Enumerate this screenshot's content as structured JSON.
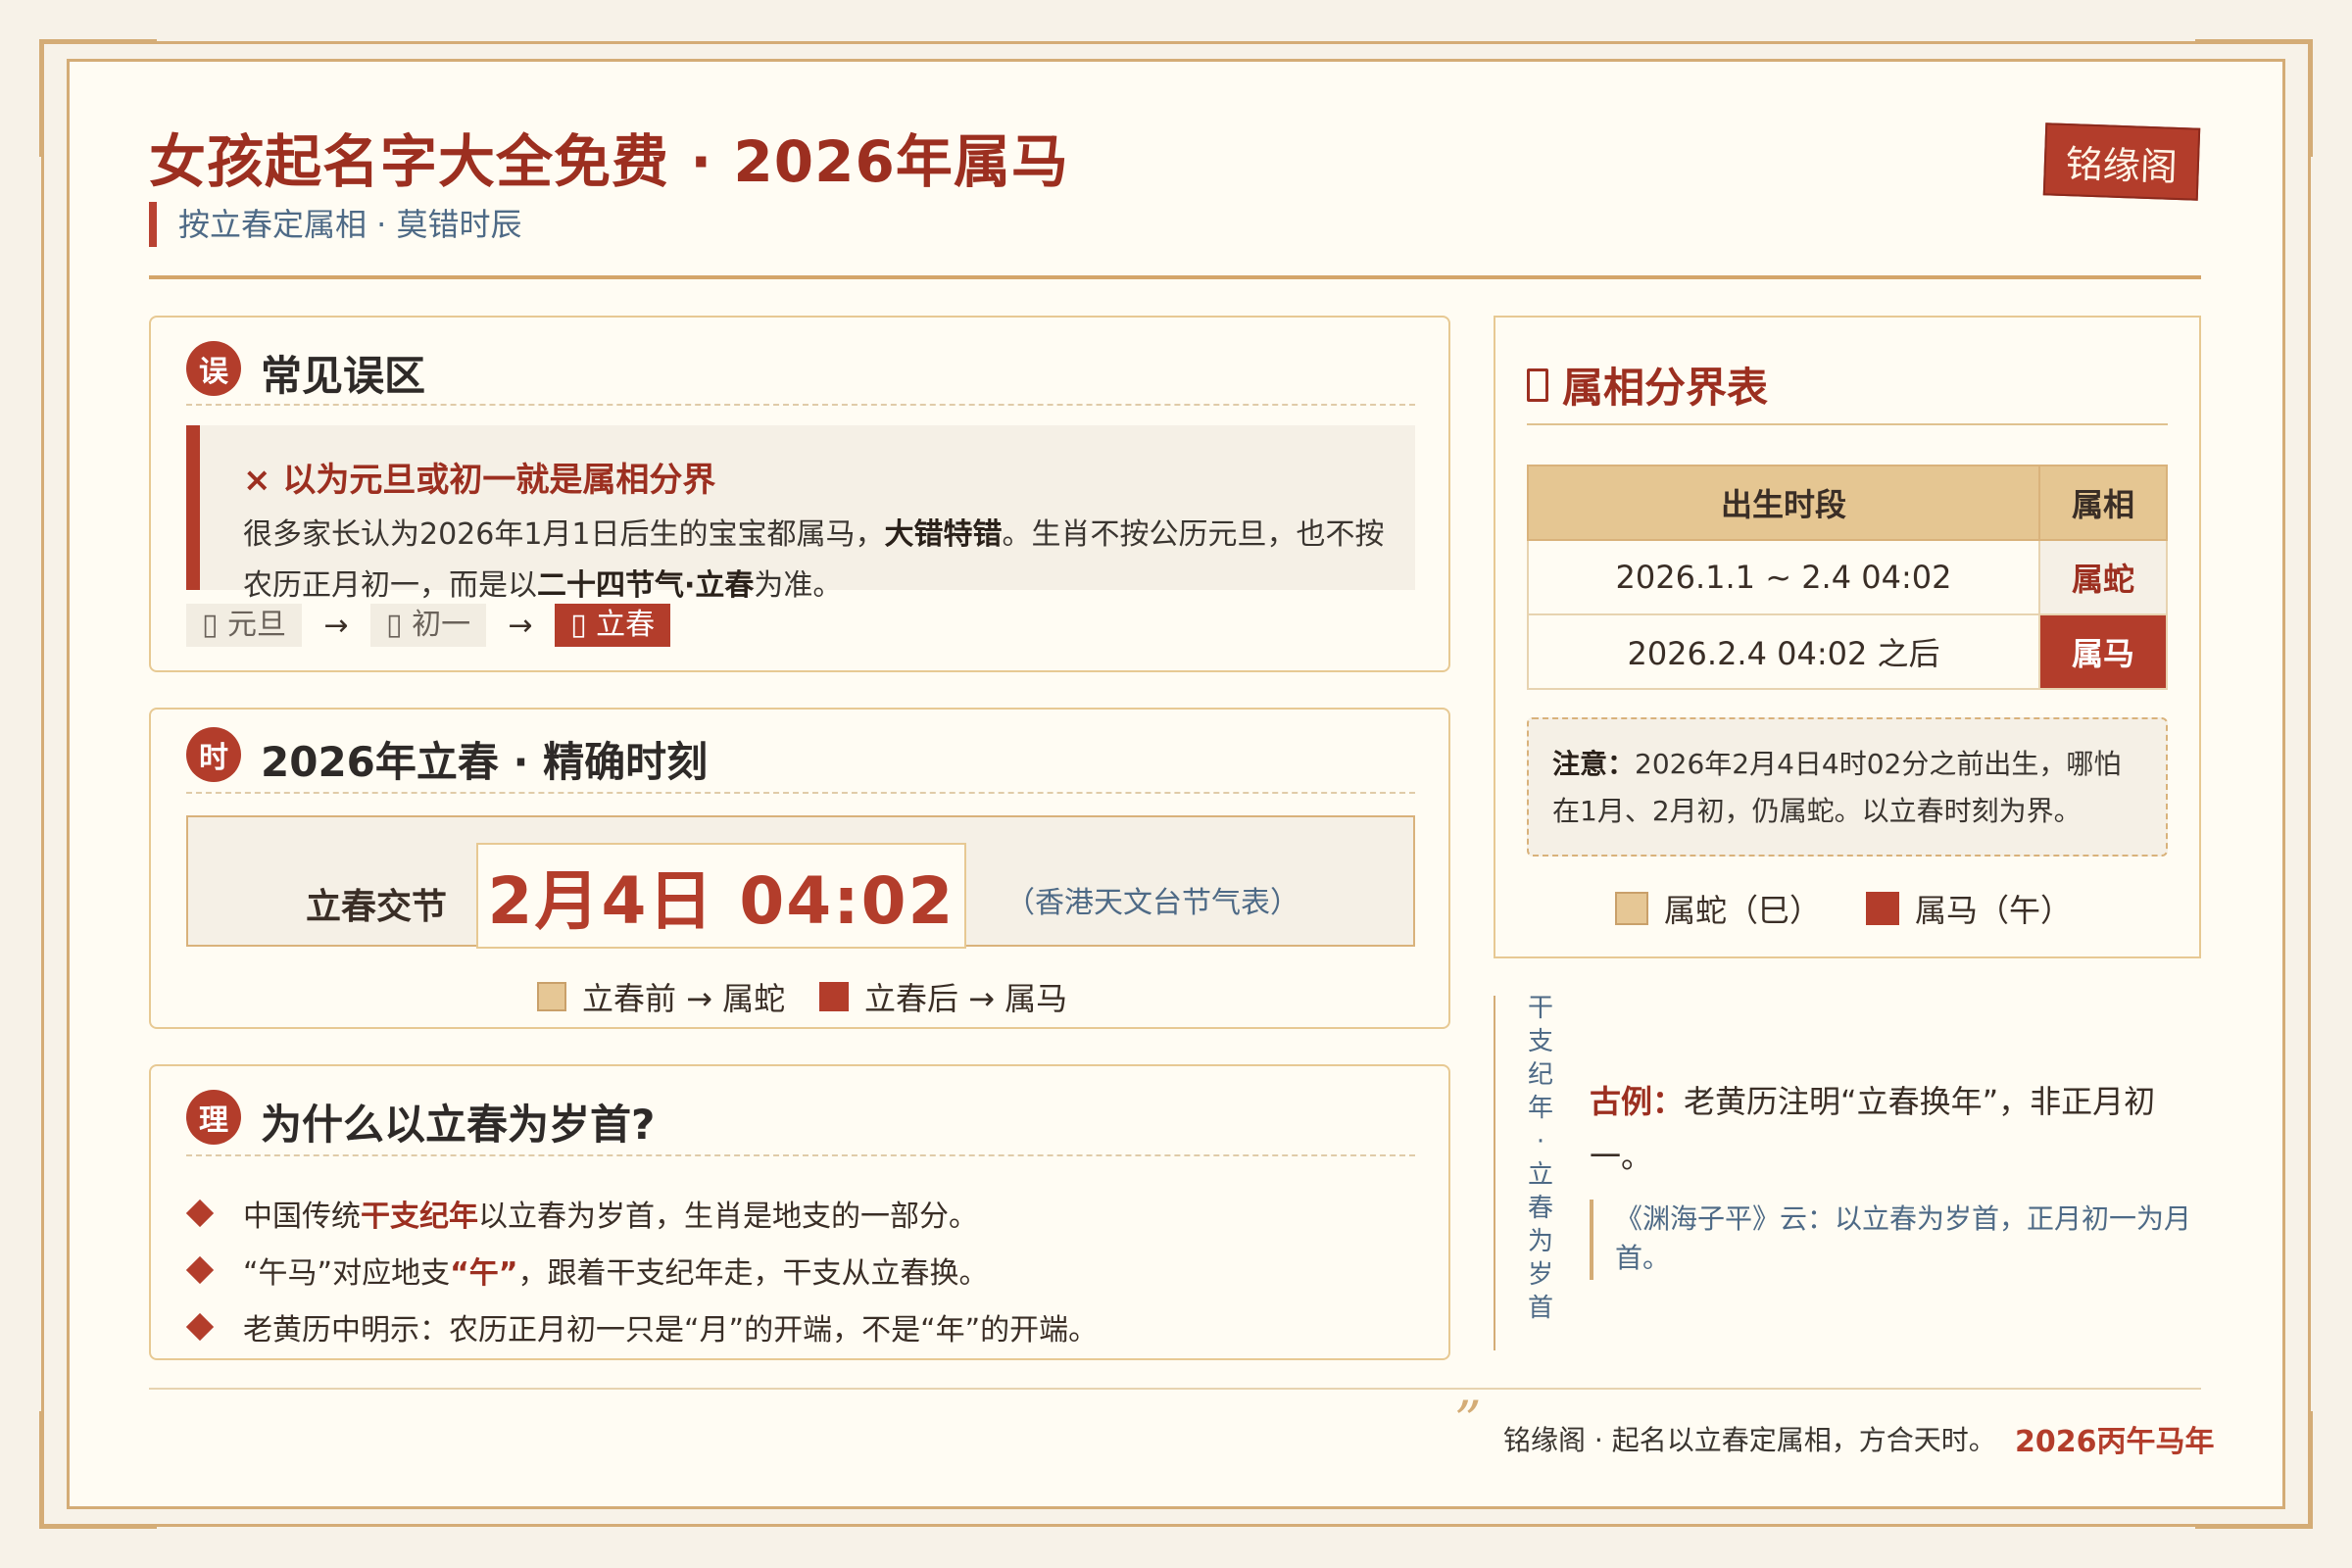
{
  "header": {
    "title": "女孩起名字大全免费 · 2026年属马",
    "subtitle": "按立春定属相 · 莫错时辰",
    "seal": "铭缘阁"
  },
  "misconception": {
    "badge": "误",
    "title": "常见误区",
    "error_title": "× 以为元旦或初一就是属相分界",
    "text_1": "很多家长认为2026年1月1日后生的宝宝都属马，",
    "text_bold_1": "大错特错",
    "text_2": "。生肖不按公历元旦，也不按农历正月初一，而是以",
    "text_bold_2": "二十四节气·立春",
    "text_3": "为准。",
    "chips": [
      "▯ 元旦",
      "▯ 初一",
      "▯ 立春"
    ],
    "arrow": "→"
  },
  "lichun": {
    "badge": "时",
    "title": "2026年立春 · 精确时刻",
    "label": "立春交节",
    "time": "2月4日 04:02",
    "source": "（香港天文台节气表）",
    "legend_before": "立春前 → 属蛇",
    "legend_after": "立春后 → 属马"
  },
  "reason": {
    "badge": "理",
    "title": "为什么以立春为岁首?",
    "items": [
      {
        "pre": "中国传统",
        "em": "干支纪年",
        "post": "以立春为岁首，生肖是地支的一部分。"
      },
      {
        "pre": "“午马”对应地支",
        "em": "“午”",
        "post": "，跟着干支纪年走，干支从立春换。"
      },
      {
        "pre": "老黄历中明示：农历正月初一只是“月”的开端，不是“年”的开端。",
        "em": "",
        "post": ""
      }
    ]
  },
  "boundary_table": {
    "title": "属相分界表",
    "headers": [
      "出生时段",
      "属相"
    ],
    "rows": [
      {
        "period": "2026.1.1 ~ 2.4 04:02",
        "zodiac": "属蛇"
      },
      {
        "period": "2026.2.4 04:02 之后",
        "zodiac": "属马"
      }
    ],
    "note_bold": "注意：",
    "note": "2026年2月4日4时02分之前出生，哪怕在1月、2月初，仍属蛇。以立春时刻为界。",
    "legend_snake": "属蛇（巳）",
    "legend_horse": "属马（午）"
  },
  "side": {
    "vertical": "干支纪年·立春为岁首",
    "example_bold": "古例：",
    "example": "老黄历注明“立春换年”，非正月初一。",
    "quote": "《渊海子平》云：以立春为岁首，正月初一为月首。"
  },
  "footer": {
    "quote_mark": "”",
    "text": "铭缘阁 · 起名以立春定属相，方合天时。",
    "year": "2026丙午马年"
  },
  "colors": {
    "accent": "#b33d2b",
    "title": "#9c2f20",
    "gold": "#d4ac76",
    "paper": "#fffcf3",
    "blue_text": "#4e6a86",
    "snake_swatch": "#e6c795"
  }
}
